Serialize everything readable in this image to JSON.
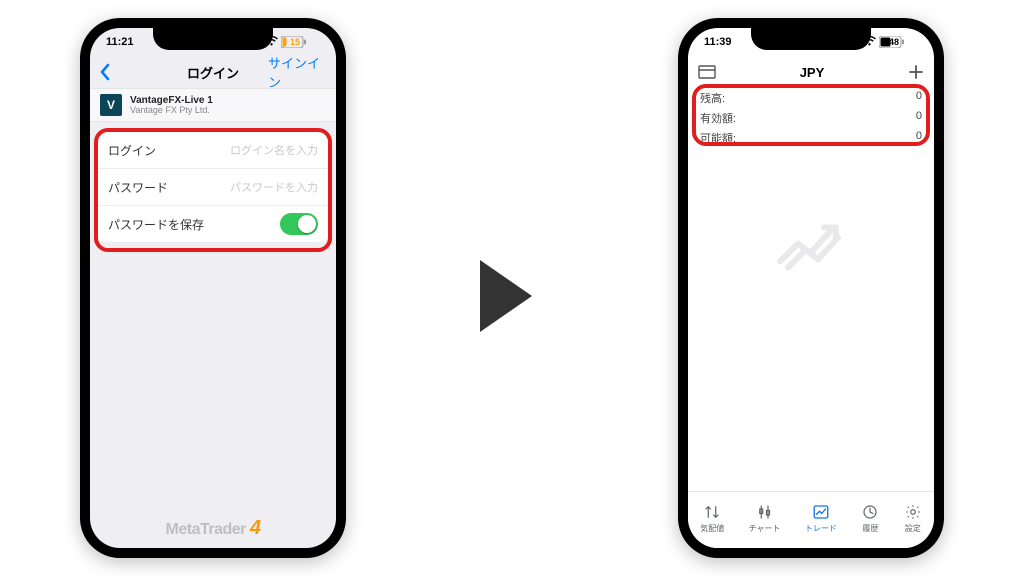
{
  "left": {
    "status_time": "11:21",
    "battery": "15",
    "nav": {
      "title": "ログイン",
      "signin": "サインイン"
    },
    "broker": {
      "logo_letter": "V",
      "name": "VantageFX-Live 1",
      "company": "Vantage FX Pty Ltd."
    },
    "form": {
      "login_label": "ログイン",
      "login_placeholder": "ログイン名を入力",
      "password_label": "パスワード",
      "password_placeholder": "パスワードを入力",
      "save_password_label": "パスワードを保存"
    },
    "footer": "MetaTrader",
    "footer_num": "4"
  },
  "right": {
    "status_time": "11:39",
    "battery": "48",
    "nav_currency": "JPY",
    "balances": {
      "row1_label": "残高:",
      "row1_value": "0",
      "row2_label": "有効額:",
      "row2_value": "0",
      "row3_label": "可能額:",
      "row3_value": "0"
    },
    "tabs": {
      "t1": "気配値",
      "t2": "チャート",
      "t3": "トレード",
      "t4": "履歴",
      "t5": "設定"
    }
  }
}
